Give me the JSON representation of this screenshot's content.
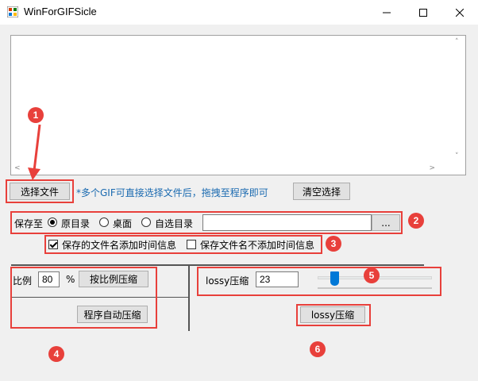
{
  "window": {
    "title": "WinForGIFSicle",
    "icon": "app-grid-icon",
    "controls": [
      "minimize-icon",
      "maximize-icon",
      "close-icon"
    ]
  },
  "file_list": {
    "items": []
  },
  "file_row": {
    "select_button": "选择文件",
    "hint": "*多个GIF可直接选择文件后，拖拽至程序即可",
    "clear_button": "清空选择"
  },
  "save_to": {
    "label": "保存至",
    "options": [
      "原目录",
      "桌面",
      "自选目录"
    ],
    "selected": "原目录",
    "path_value": "",
    "browse_button": "..."
  },
  "name_options": {
    "add_time": "保存的文件名添加时间信息",
    "add_time_checked": true,
    "no_time": "保存文件名不添加时间信息",
    "no_time_checked": false
  },
  "ratio": {
    "label": "比例",
    "value": "80",
    "unit": "%",
    "compress_button": "按比例压缩",
    "auto_button": "程序自动压缩"
  },
  "lossy": {
    "label": "lossy压缩",
    "value": "23",
    "slider_fraction": 0.12,
    "compress_button": "lossy压缩"
  },
  "annotations": [
    "1",
    "2",
    "3",
    "4",
    "5",
    "6"
  ],
  "colors": {
    "annotation": "#e8403b",
    "hint": "#1a6ab0",
    "slider_thumb": "#0078d7"
  }
}
